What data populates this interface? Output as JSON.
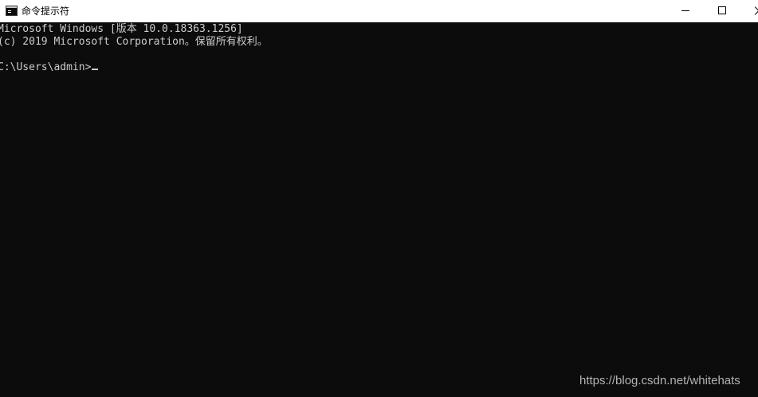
{
  "window": {
    "title": "命令提示符",
    "app_icon": "console-app-icon",
    "controls": {
      "minimize": "minimize-icon",
      "maximize": "maximize-icon",
      "close": "close-icon"
    }
  },
  "console": {
    "lines": [
      "Microsoft Windows [版本 10.0.18363.1256]",
      "(c) 2019 Microsoft Corporation。保留所有权利。",
      "",
      "C:\\Users\\admin>"
    ],
    "colors": {
      "background": "#0c0c0c",
      "foreground": "#cccccc"
    }
  },
  "watermark": "https://blog.csdn.net/whitehats"
}
